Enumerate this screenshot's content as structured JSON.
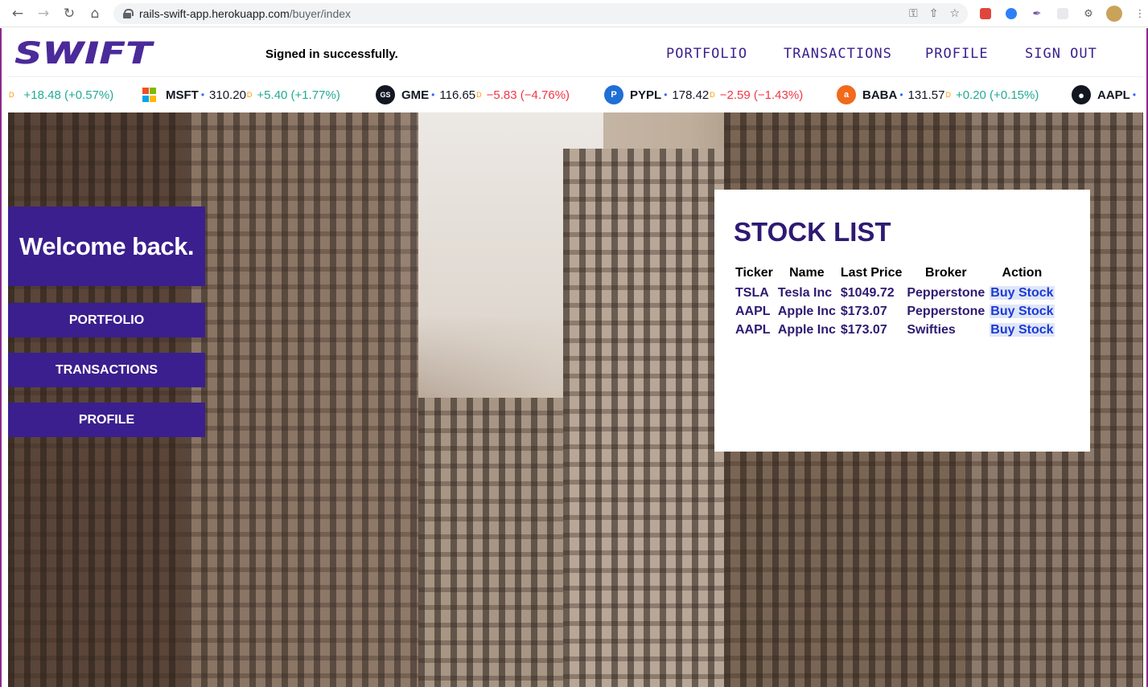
{
  "browser": {
    "url_host": "rails-swift-app.herokuapp.com",
    "url_path": "/buyer/index"
  },
  "header": {
    "logo": "SWIFT",
    "flash": "Signed in successfully.",
    "nav": [
      "PORTFOLIO",
      "TRANSACTIONS",
      "PROFILE",
      "SIGN OUT"
    ]
  },
  "ticker": [
    {
      "symbol": "",
      "price": "",
      "change": "+18.48 (+0.57%)",
      "dir": "up",
      "logo_color": "",
      "logo_text": ""
    },
    {
      "symbol": "MSFT",
      "price": "310.20",
      "change": "+5.40 (+1.77%)",
      "dir": "up",
      "logo_color": "#ffffff",
      "logo_text": ""
    },
    {
      "symbol": "GME",
      "price": "116.65",
      "change": "−5.83 (−4.76%)",
      "dir": "down",
      "logo_color": "#131722",
      "logo_text": "GS"
    },
    {
      "symbol": "PYPL",
      "price": "178.42",
      "change": "−2.59 (−1.43%)",
      "dir": "down",
      "logo_color": "#1f6fd6",
      "logo_text": "P"
    },
    {
      "symbol": "BABA",
      "price": "131.57",
      "change": "+0.20 (+0.15%)",
      "dir": "up",
      "logo_color": "#f26a1b",
      "logo_text": "a"
    },
    {
      "symbol": "AAPL",
      "price": "",
      "change": "",
      "dir": "up",
      "logo_color": "#131722",
      "logo_text": ""
    }
  ],
  "ticker_d": "D",
  "sidebar": {
    "welcome": "Welcome back.",
    "buttons": [
      "PORTFOLIO",
      "TRANSACTIONS",
      "PROFILE"
    ]
  },
  "stock_list": {
    "title": "STOCK LIST",
    "columns": [
      "Ticker",
      "Name",
      "Last Price",
      "Broker",
      "Action"
    ],
    "rows": [
      {
        "ticker": "TSLA",
        "name": "Tesla Inc",
        "price": "$1049.72",
        "broker": "Pepperstone",
        "action": "Buy Stock"
      },
      {
        "ticker": "AAPL",
        "name": "Apple Inc",
        "price": "$173.07",
        "broker": "Pepperstone",
        "action": "Buy Stock"
      },
      {
        "ticker": "AAPL",
        "name": "Apple Inc",
        "price": "$173.07",
        "broker": "Swifties",
        "action": "Buy Stock"
      }
    ]
  },
  "colors": {
    "brand": "#3b1f8e",
    "title": "#2e1a72",
    "link": "#1a3bd6",
    "up": "#22ab94",
    "down": "#f23645"
  }
}
